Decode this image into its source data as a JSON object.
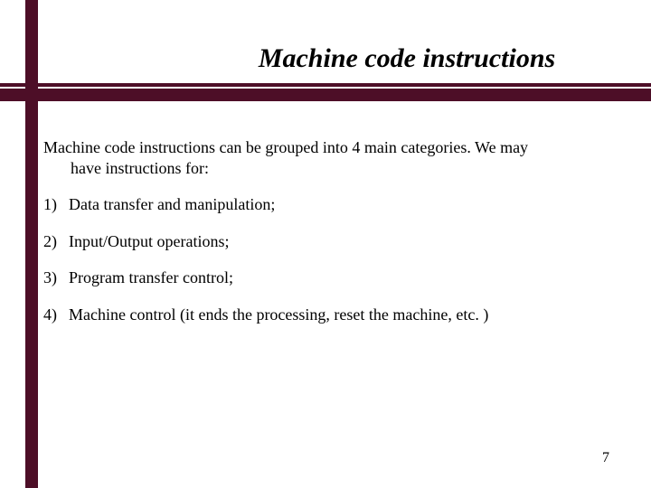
{
  "title": "Machine code instructions",
  "intro_line1": "Machine code instructions can be grouped into 4 main categories. We may",
  "intro_line2": "have instructions for:",
  "items": [
    {
      "num": "1)",
      "text": "Data transfer and manipulation;"
    },
    {
      "num": "2)",
      "text": "Input/Output operations;"
    },
    {
      "num": "3)",
      "text": "Program transfer control;"
    },
    {
      "num": "4)",
      "text": "Machine control (it ends the processing, reset the machine, etc. )"
    }
  ],
  "page_number": "7"
}
